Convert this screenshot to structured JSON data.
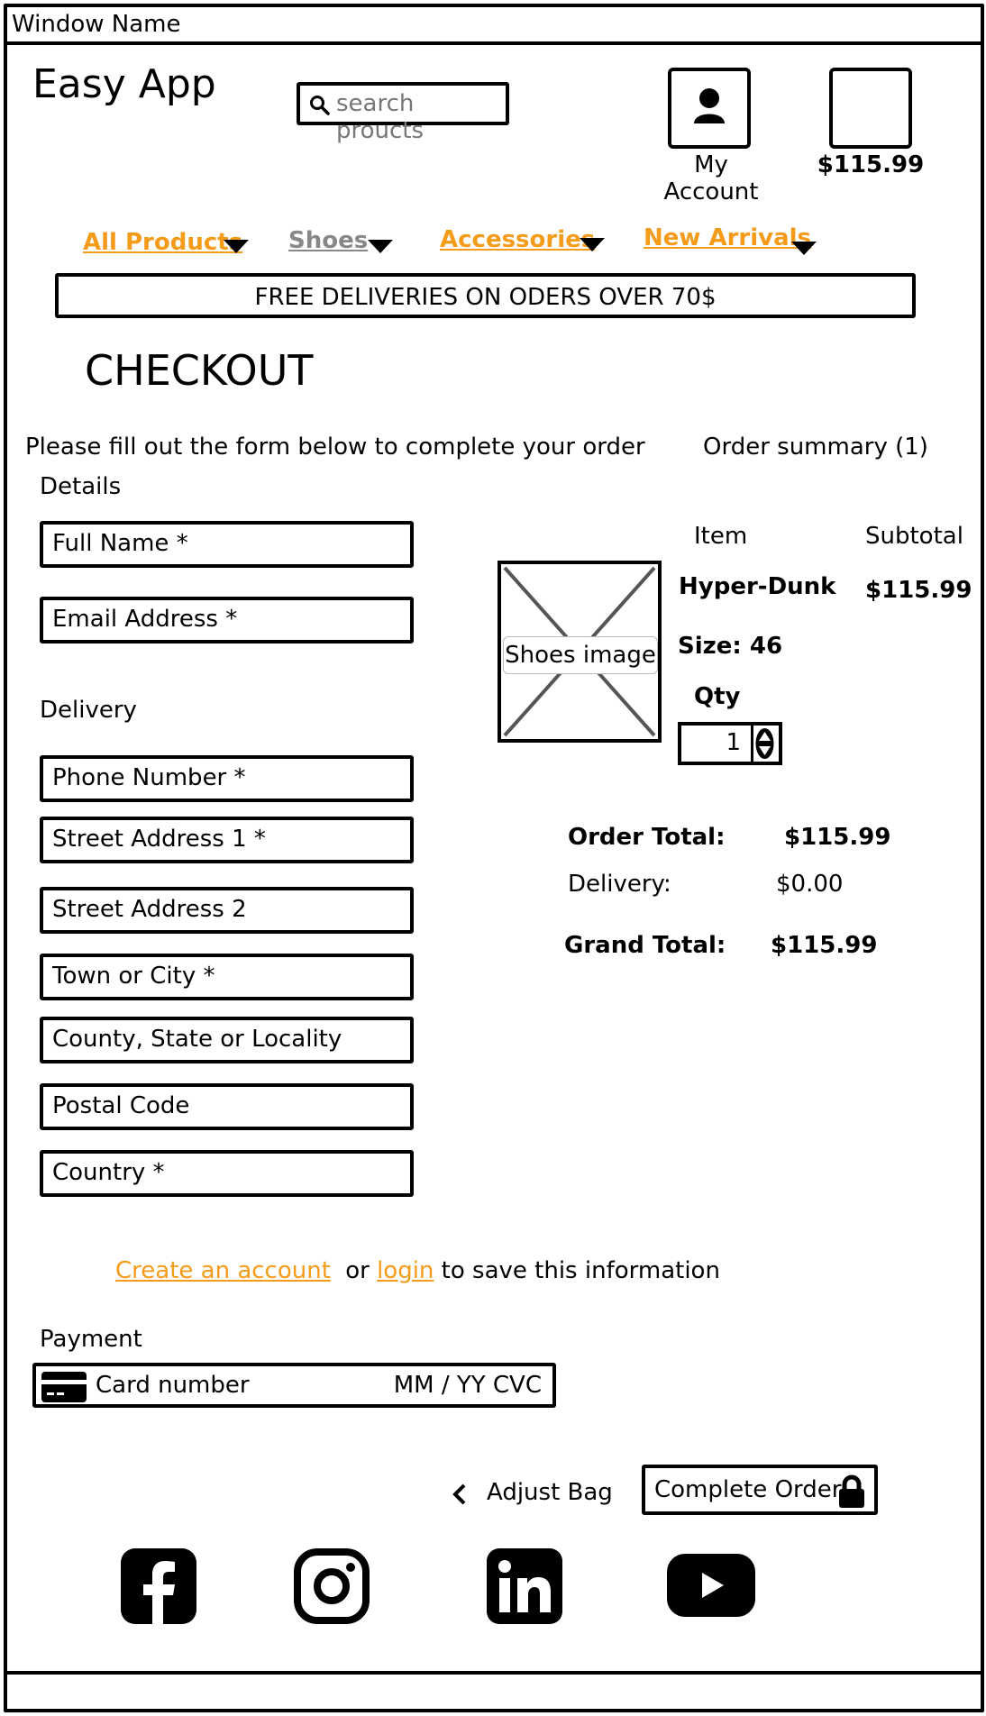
{
  "window": {
    "title": "Window Name"
  },
  "header": {
    "logo": "Easy App",
    "search_placeholder": "search proucts",
    "account_label": "My Account",
    "cart_total": "$115.99"
  },
  "nav": {
    "items": [
      {
        "label": "All Products",
        "color": "#f59b1a"
      },
      {
        "label": "Shoes",
        "color": "#888888"
      },
      {
        "label": "Accessories",
        "color": "#f59b1a"
      },
      {
        "label": "New Arrivals",
        "color": "#f59b1a"
      }
    ]
  },
  "banner": "FREE DELIVERIES ON ODERS OVER 70$",
  "page_title": "CHECKOUT",
  "form": {
    "intro": "Please fill out the form below to complete your order",
    "details_heading": "Details",
    "delivery_heading": "Delivery",
    "fields": {
      "full_name": "Full Name *",
      "email": "Email Address *",
      "phone": "Phone Number *",
      "street1": "Street Address 1 *",
      "street2": "Street Address 2",
      "town": "Town or City *",
      "county": "County, State or Locality",
      "postal": "Postal Code",
      "country": "Country *"
    },
    "save_info": {
      "create_account": "Create an account",
      "or": "or",
      "login": "login",
      "suffix": "to save this information"
    },
    "payment_heading": "Payment",
    "payment": {
      "card_number": "Card number",
      "expiry_cvc": "MM / YY CVC"
    }
  },
  "summary": {
    "title": "Order summary (1)",
    "col_item": "Item",
    "col_subtotal": "Subtotal",
    "image_label": "Shoes image",
    "product_name": "Hyper-Dunk",
    "product_subtotal": "$115.99",
    "size": "Size: 46",
    "qty_label": "Qty",
    "qty_value": "1",
    "order_total_label": "Order Total:",
    "order_total": "$115.99",
    "delivery_label": "Delivery:",
    "delivery": "$0.00",
    "grand_total_label": "Grand Total:",
    "grand_total": "$115.99"
  },
  "actions": {
    "adjust_bag": "Adjust Bag",
    "complete_order": "Complete Order"
  },
  "social_icons": [
    "facebook-icon",
    "instagram-icon",
    "linkedin-icon",
    "youtube-icon"
  ]
}
